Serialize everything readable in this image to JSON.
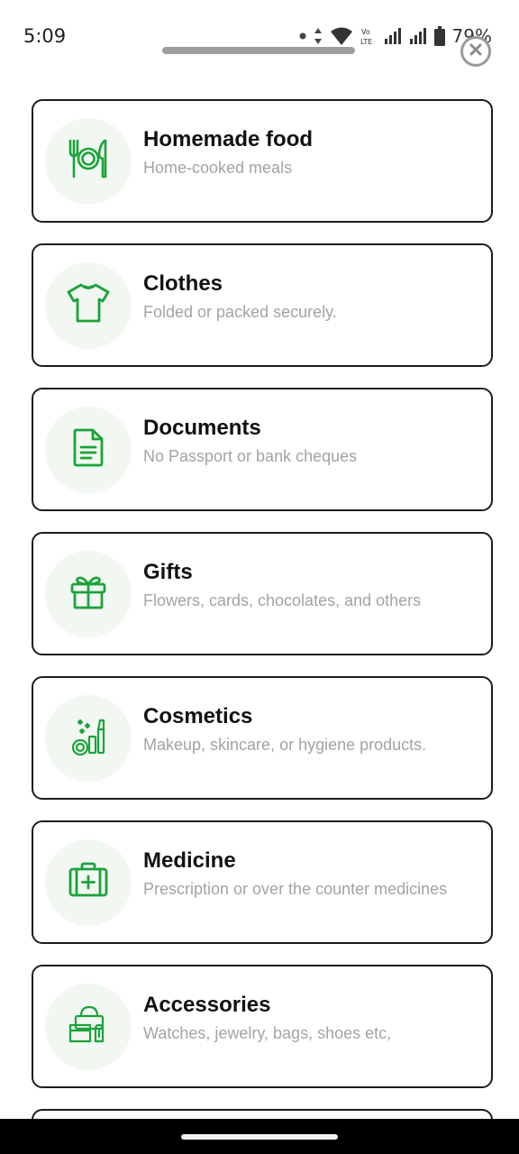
{
  "status": {
    "time": "5:09",
    "battery": "79%",
    "network_label": "Vo LTE"
  },
  "colors": {
    "accent": "#1aa33a",
    "icon_bg": "#f2f7f2",
    "border": "#1c1c1c",
    "subtitle": "#a3a3a3"
  },
  "categories": [
    {
      "title": "Homemade food",
      "subtitle": "Home-cooked meals",
      "icon": "plate-cutlery-icon"
    },
    {
      "title": "Clothes",
      "subtitle": "Folded or packed securely.",
      "icon": "tshirt-icon"
    },
    {
      "title": "Documents",
      "subtitle": "No Passport or bank cheques",
      "icon": "document-icon"
    },
    {
      "title": "Gifts",
      "subtitle": "Flowers, cards, chocolates, and others",
      "icon": "gift-icon"
    },
    {
      "title": "Cosmetics",
      "subtitle": "Makeup, skincare, or hygiene products.",
      "icon": "cosmetics-icon"
    },
    {
      "title": "Medicine",
      "subtitle": "Prescription or over the counter medicines",
      "icon": "medical-kit-icon"
    },
    {
      "title": "Accessories",
      "subtitle": "Watches, jewelry, bags, shoes etc,",
      "icon": "bag-accessories-icon"
    }
  ]
}
